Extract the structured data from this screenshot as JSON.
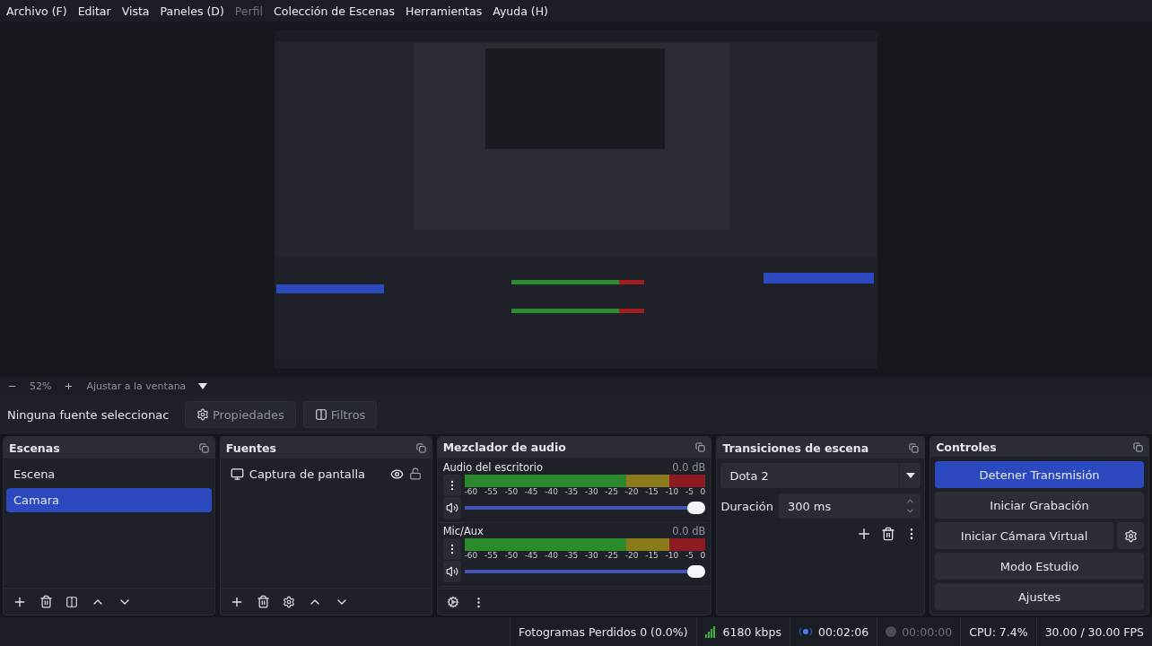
{
  "menu": [
    {
      "label": "Archivo (F)",
      "disabled": false
    },
    {
      "label": "Editar",
      "disabled": false
    },
    {
      "label": "Vista",
      "disabled": false
    },
    {
      "label": "Paneles (D)",
      "disabled": false
    },
    {
      "label": "Perfil",
      "disabled": true
    },
    {
      "label": "Colección de Escenas",
      "disabled": false
    },
    {
      "label": "Herramientas",
      "disabled": false
    },
    {
      "label": "Ayuda (H)",
      "disabled": false
    }
  ],
  "zoom_bar": {
    "zoom": "52%",
    "fit": "Ajustar a la ventana"
  },
  "source_bar": {
    "label": "Ninguna fuente seleccionac",
    "buttons": [
      {
        "label": "Propiedades",
        "kind": "gear"
      },
      {
        "label": "Filtros",
        "kind": "filter"
      }
    ]
  },
  "scenes": {
    "title": "Escenas",
    "items": [
      {
        "label": "Escena",
        "selected": false
      },
      {
        "label": "Camara",
        "selected": true
      }
    ]
  },
  "sources": {
    "title": "Fuentes",
    "items": [
      {
        "label": "Captura de pantalla",
        "visible": true,
        "locked": false
      }
    ]
  },
  "mixer": {
    "title": "Mezclador de audio",
    "channels": [
      {
        "name": "Audio del escritorio",
        "reading": "0.0 dB",
        "muted": false,
        "level": 1,
        "scale": [
          "-60",
          "-55",
          "-50",
          "-45",
          "-40",
          "-35",
          "-30",
          "-25",
          "-20",
          "-15",
          "-10",
          "-5",
          "0"
        ]
      },
      {
        "name": "Mic/Aux",
        "reading": "0.0 dB",
        "muted": false,
        "level": 1,
        "scale": [
          "-60",
          "-55",
          "-50",
          "-45",
          "-40",
          "-35",
          "-30",
          "-25",
          "-20",
          "-15",
          "-10",
          "-5",
          "0"
        ]
      }
    ]
  },
  "transitions": {
    "title": "Transiciones de escena",
    "selected": "Dota 2",
    "duration_label": "Duración",
    "duration": "300 ms"
  },
  "controls": {
    "title": "Controles",
    "buttons": [
      {
        "label": "Detener Transmisión",
        "active": true,
        "settings": false
      },
      {
        "label": "Iniciar Grabación",
        "active": false,
        "settings": false
      },
      {
        "label": "Iniciar Cámara Virtual",
        "active": false,
        "settings": true
      },
      {
        "label": "Modo Estudio",
        "active": false,
        "settings": false
      },
      {
        "label": "Ajustes",
        "active": false,
        "settings": false
      }
    ]
  },
  "status": {
    "dropped": "Fotogramas Perdidos 0 (0.0%)",
    "bitrate": "6180 kbps",
    "streaming": true,
    "stream_time": "00:02:06",
    "recording": false,
    "record_time": "00:00:00",
    "cpu": "CPU: 7.4%",
    "fps": "30.00 / 30.00 FPS"
  }
}
